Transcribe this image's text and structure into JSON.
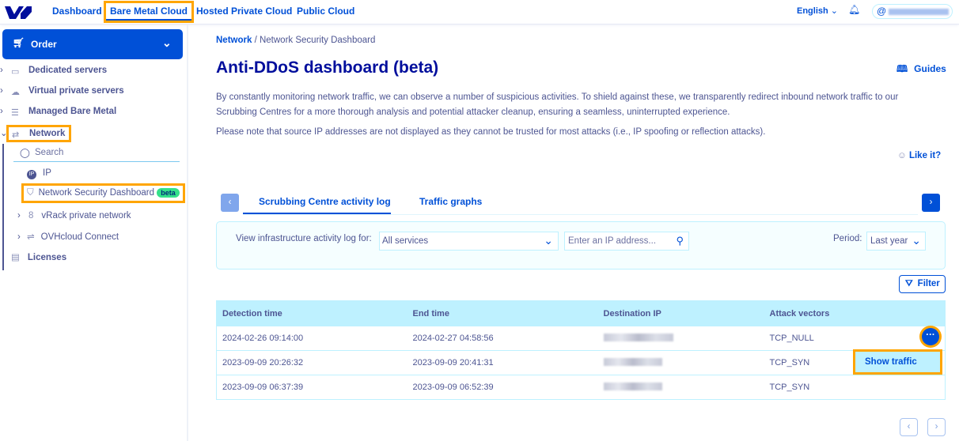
{
  "topbar": {
    "nav": [
      "Dashboard",
      "Bare Metal Cloud",
      "Hosted Private Cloud",
      "Public Cloud"
    ],
    "language": "English"
  },
  "sidebar": {
    "order": "Order",
    "items": [
      "Dedicated servers",
      "Virtual private servers",
      "Managed Bare Metal",
      "Network"
    ],
    "search_placeholder": "Search",
    "sub": [
      "IP",
      "Network Security Dashboard",
      "vRack private network",
      "OVHcloud Connect"
    ],
    "beta": "beta",
    "licenses": "Licenses"
  },
  "breadcrumb": {
    "parent": "Network",
    "sep": "/",
    "current": "Network Security Dashboard"
  },
  "page": {
    "title": "Anti-DDoS dashboard (beta)",
    "guides": "Guides",
    "desc1": "By constantly monitoring network traffic, we can observe a number of suspicious activities. To shield against these, we transparently redirect inbound network traffic to our Scrubbing Centres for a more thorough analysis and potential attacker cleanup, ensuring a seamless, uninterrupted experience.",
    "desc2": "Please note that source IP addresses are not displayed as they cannot be trusted for most attacks (i.e., IP spoofing or reflection attacks).",
    "like": "Like it?"
  },
  "tabs": [
    "Scrubbing Centre activity log",
    "Traffic graphs"
  ],
  "filters": {
    "label": "View infrastructure activity log for:",
    "service": "All services",
    "ip_placeholder": "Enter an IP address...",
    "period_label": "Period:",
    "period": "Last year",
    "filter_btn": "Filter"
  },
  "table": {
    "headers": [
      "Detection time",
      "End time",
      "Destination IP",
      "Attack vectors"
    ],
    "rows": [
      [
        "2024-02-26 09:14:00",
        "2024-02-27 04:58:56",
        "",
        "TCP_NULL"
      ],
      [
        "2023-09-09 20:26:32",
        "2023-09-09 20:41:31",
        "",
        "TCP_SYN"
      ],
      [
        "2023-09-09 06:37:39",
        "2023-09-09 06:52:39",
        "",
        "TCP_SYN"
      ]
    ]
  },
  "menu": {
    "show_traffic": "Show traffic"
  }
}
